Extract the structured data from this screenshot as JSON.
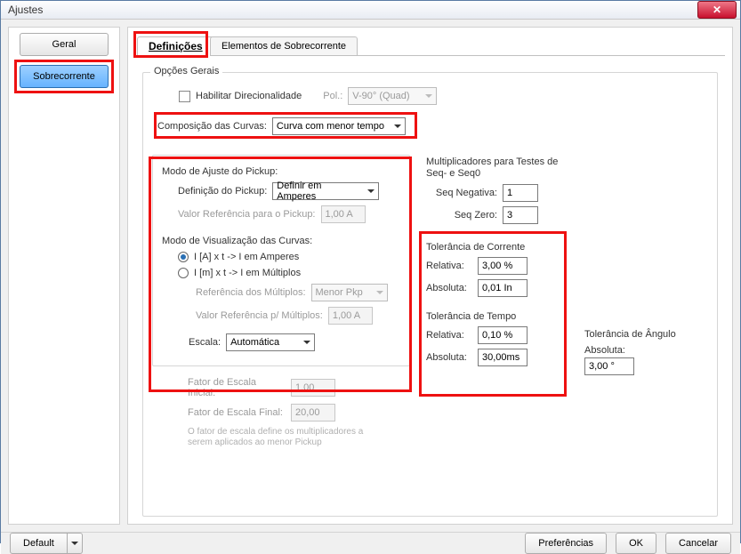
{
  "window": {
    "title": "Ajustes"
  },
  "sidebar": {
    "items": [
      {
        "label": "Geral"
      },
      {
        "label": "Sobrecorrente"
      }
    ]
  },
  "tabs": [
    {
      "label": "Definições"
    },
    {
      "label": "Elementos de Sobrecorrente"
    }
  ],
  "opcoes": {
    "group_title": "Opções Gerais",
    "habilitar_label": "Habilitar Direcionalidade",
    "pol_label": "Pol.:",
    "pol_value": "V-90° (Quad)",
    "composicao_label": "Composição das Curvas:",
    "composicao_value": "Curva com menor tempo"
  },
  "pickup": {
    "modo_ajuste_title": "Modo de Ajuste do Pickup:",
    "def_pickup_label": "Definição do Pickup:",
    "def_pickup_value": "Definir em Amperes",
    "valor_ref_label": "Valor Referência para o Pickup:",
    "valor_ref_value": "1,00 A",
    "modo_visual_title": "Modo de Visualização das Curvas:",
    "radio1": "I [A] x t -> I em Amperes",
    "radio2": "I [m] x t -> I em Múltiplos",
    "ref_mult_label": "Referência dos Múltiplos:",
    "ref_mult_value": "Menor Pkp",
    "valor_ref_mult_label": "Valor Referência p/ Múltiplos:",
    "valor_ref_mult_value": "1,00 A",
    "escala_label": "Escala:",
    "escala_value": "Automática",
    "fator_inicial_label": "Fator de Escala Inicial:",
    "fator_inicial_value": "1,00",
    "fator_final_label": "Fator de Escala Final:",
    "fator_final_value": "20,00",
    "note": "O fator de escala define os multiplicadores a serem aplicados ao menor Pickup"
  },
  "mult": {
    "title": "Multiplicadores para Testes de Seq- e Seq0",
    "seq_neg_label": "Seq Negativa:",
    "seq_neg_value": "1",
    "seq_zero_label": "Seq Zero:",
    "seq_zero_value": "3"
  },
  "tol_corrente": {
    "title": "Tolerância de Corrente",
    "rel_label": "Relativa:",
    "rel_value": "3,00 %",
    "abs_label": "Absoluta:",
    "abs_value": "0,01 In"
  },
  "tol_tempo": {
    "title": "Tolerância de Tempo",
    "rel_label": "Relativa:",
    "rel_value": "0,10 %",
    "abs_label": "Absoluta:",
    "abs_value": "30,00ms"
  },
  "tol_angulo": {
    "title": "Tolerância de Ângulo",
    "abs_label": "Absoluta:",
    "abs_value": "3,00 °"
  },
  "footer": {
    "default": "Default",
    "pref": "Preferências",
    "ok": "OK",
    "cancel": "Cancelar"
  }
}
